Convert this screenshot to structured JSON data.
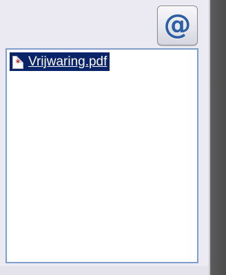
{
  "email_button": {
    "icon": "at-sign-icon",
    "glyph": "@",
    "color": "#2d5fa3"
  },
  "attachments": {
    "items": [
      {
        "name": "Vrijwaring.pdf",
        "icon": "pdf-file-icon",
        "selected": true
      }
    ],
    "border_color": "#7f9dca",
    "selection_color": "#0a246a"
  }
}
